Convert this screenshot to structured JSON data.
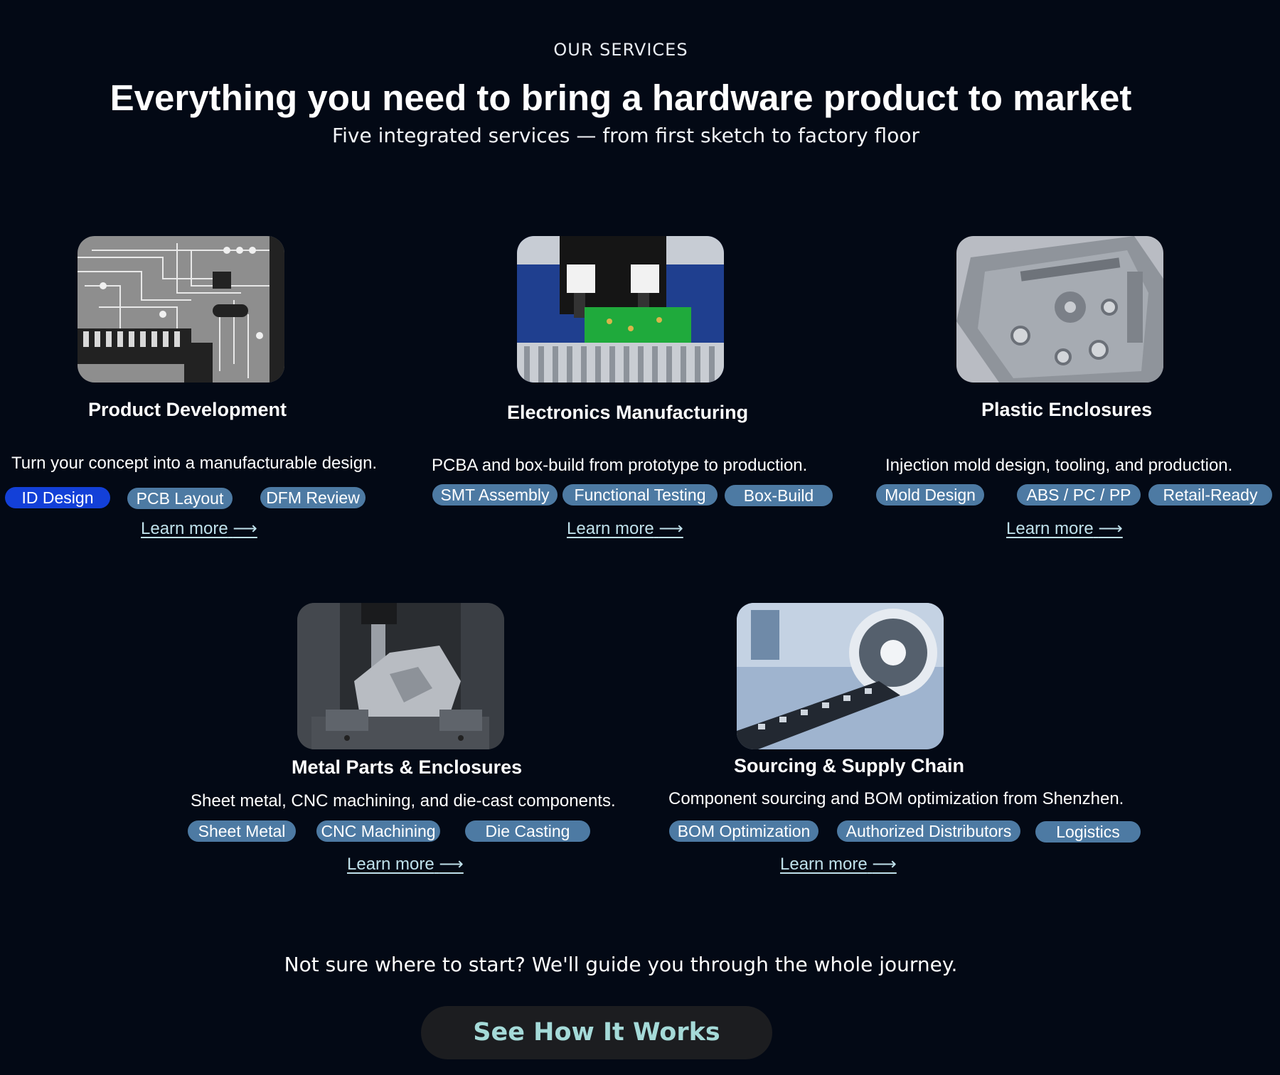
{
  "header": {
    "eyebrow": "OUR SERVICES",
    "title": "Everything you need to bring a hardware product to market",
    "subtitle": "Five integrated services — from first sketch to factory floor"
  },
  "services": [
    {
      "title": "Product Development",
      "description": "Turn your concept into a manufacturable design.",
      "tags": [
        {
          "label": "ID Design",
          "active": true
        },
        {
          "label": "PCB Layout",
          "active": false
        },
        {
          "label": "DFM Review",
          "active": false
        }
      ],
      "link": "Learn more",
      "image": "circuit-board-image"
    },
    {
      "title": "Electronics Manufacturing",
      "description": "PCBA and box-build from prototype to production.",
      "tags": [
        {
          "label": "SMT Assembly",
          "active": false
        },
        {
          "label": "Functional Testing",
          "active": false
        },
        {
          "label": "Box-Build",
          "active": false
        }
      ],
      "link": "Learn more",
      "image": "pick-and-place-machine-image"
    },
    {
      "title": "Plastic Enclosures",
      "description": "Injection mold design, tooling, and production.",
      "tags": [
        {
          "label": "Mold Design",
          "active": false
        },
        {
          "label": "ABS / PC / PP",
          "active": false
        },
        {
          "label": "Retail-Ready",
          "active": false
        }
      ],
      "link": "Learn more",
      "image": "plastic-enclosure-image"
    },
    {
      "title": "Metal Parts & Enclosures",
      "description": "Sheet metal, CNC machining, and die-cast components.",
      "tags": [
        {
          "label": "Sheet Metal",
          "active": false
        },
        {
          "label": "CNC Machining",
          "active": false
        },
        {
          "label": "Die Casting",
          "active": false
        }
      ],
      "link": "Learn more",
      "image": "cnc-machining-image"
    },
    {
      "title": "Sourcing & Supply Chain",
      "description": "Component sourcing and BOM optimization from Shenzhen.",
      "tags": [
        {
          "label": "BOM Optimization",
          "active": false
        },
        {
          "label": "Authorized Distributors",
          "active": false
        },
        {
          "label": "Logistics",
          "active": false
        }
      ],
      "link": "Learn more",
      "image": "component-reel-image"
    }
  ],
  "footer": {
    "note": "Not sure where to start? We'll guide you through the whole journey.",
    "cta_label": "See How It Works"
  },
  "colors": {
    "background": "#030915",
    "tag": "#4d7aa3",
    "tag_active": "#1340d8",
    "link": "#bfe0ea",
    "cta_text": "#a5dad8",
    "cta_bg": "#1c1d20"
  },
  "icons": {
    "link_arrow": "arrow-right-icon"
  }
}
